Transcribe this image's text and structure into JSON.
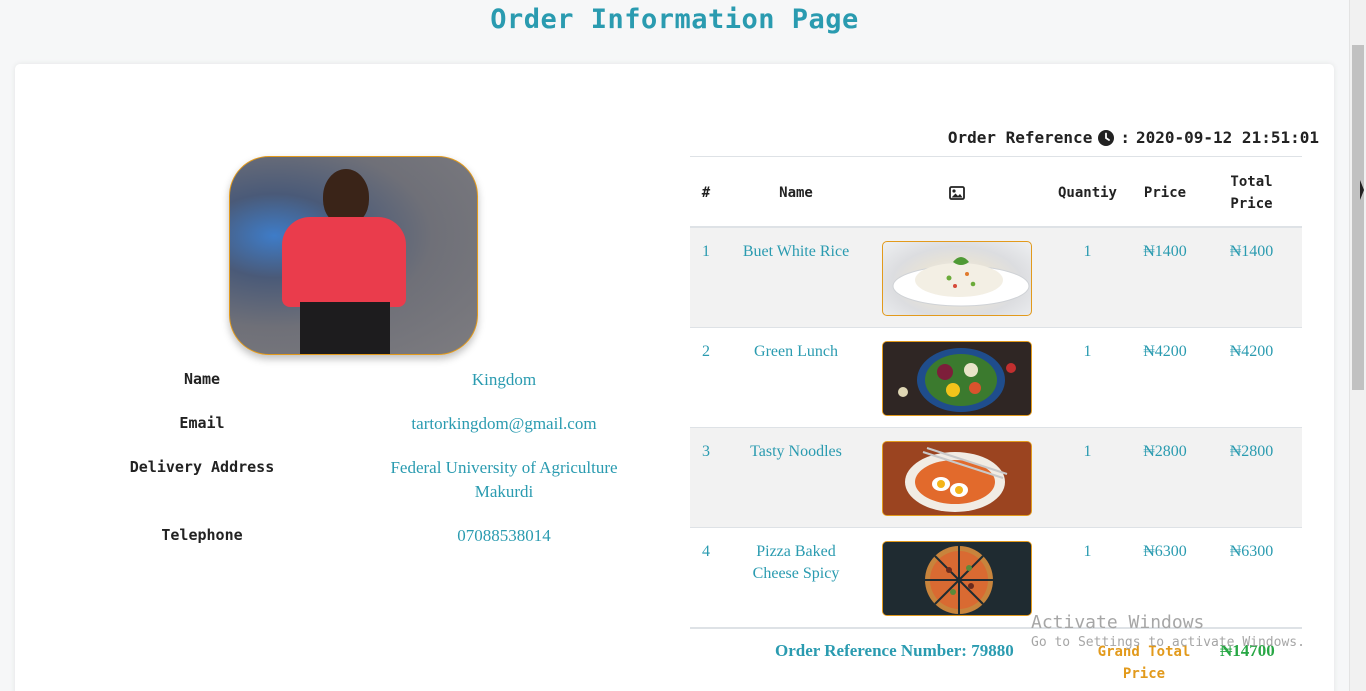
{
  "page": {
    "title": "Order Information Page"
  },
  "profile": {
    "labels": {
      "name": "Name",
      "email": "Email",
      "address": "Delivery Address",
      "telephone": "Telephone"
    },
    "values": {
      "name": "Kingdom",
      "email": "tartorkingdom@gmail.com",
      "address_line1": "Federal University of Agriculture",
      "address_line2": "Makurdi",
      "telephone": "07088538014"
    }
  },
  "order": {
    "reference_label": "Order Reference",
    "reference_separator": ":",
    "timestamp": "2020-09-12 21:51:01",
    "headers": {
      "num": "#",
      "name": "Name",
      "image_icon": "image-icon",
      "quantity": "Quantiy",
      "price": "Price",
      "total_line1": "Total",
      "total_line2": "Price"
    },
    "items": [
      {
        "num": "1",
        "name": "Buet White Rice",
        "qty": "1",
        "price": "₦1400",
        "total": "₦1400"
      },
      {
        "num": "2",
        "name": "Green Lunch",
        "qty": "1",
        "price": "₦4200",
        "total": "₦4200"
      },
      {
        "num": "3",
        "name": "Tasty Noodles",
        "qty": "1",
        "price": "₦2800",
        "total": "₦2800"
      },
      {
        "num": "4",
        "name": "Pizza Baked Cheese Spicy",
        "qty": "1",
        "price": "₦6300",
        "total": "₦6300"
      }
    ],
    "reference_number_text": "Order Reference Number: 79880",
    "grand_total_line1": "Grand Total",
    "grand_total_line2": "Price",
    "grand_total_value": "₦14700"
  },
  "watermark": {
    "title": "Activate Windows",
    "subtitle": "Go to Settings to activate Windows."
  },
  "colors": {
    "accent": "#2a9bb0",
    "orange": "#e29a1c",
    "green": "#28a745"
  }
}
